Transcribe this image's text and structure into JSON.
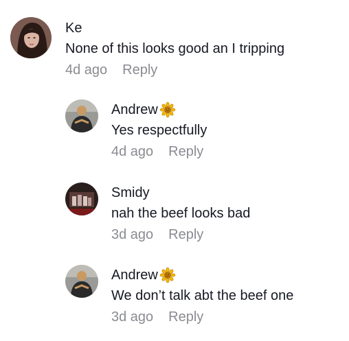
{
  "comments": [
    {
      "username": "Ke",
      "badge_icon": "",
      "text": "None of this looks good an I tripping",
      "time": "4d ago",
      "reply_label": "Reply"
    },
    {
      "username": "Andrew",
      "badge_icon": "sunflower-icon",
      "text": "Yes respectfully",
      "time": "4d ago",
      "reply_label": "Reply"
    },
    {
      "username": "Smidy",
      "badge_icon": "",
      "text": "nah the beef looks bad",
      "time": "3d ago",
      "reply_label": "Reply"
    },
    {
      "username": "Andrew",
      "badge_icon": "sunflower-icon",
      "text": "We don’t talk abt the beef one",
      "time": "3d ago",
      "reply_label": "Reply"
    }
  ],
  "colors": {
    "text_primary": "#161823",
    "text_secondary": "#8a8b91",
    "badge_petal": "#f5b800",
    "badge_center": "#c47a00"
  }
}
